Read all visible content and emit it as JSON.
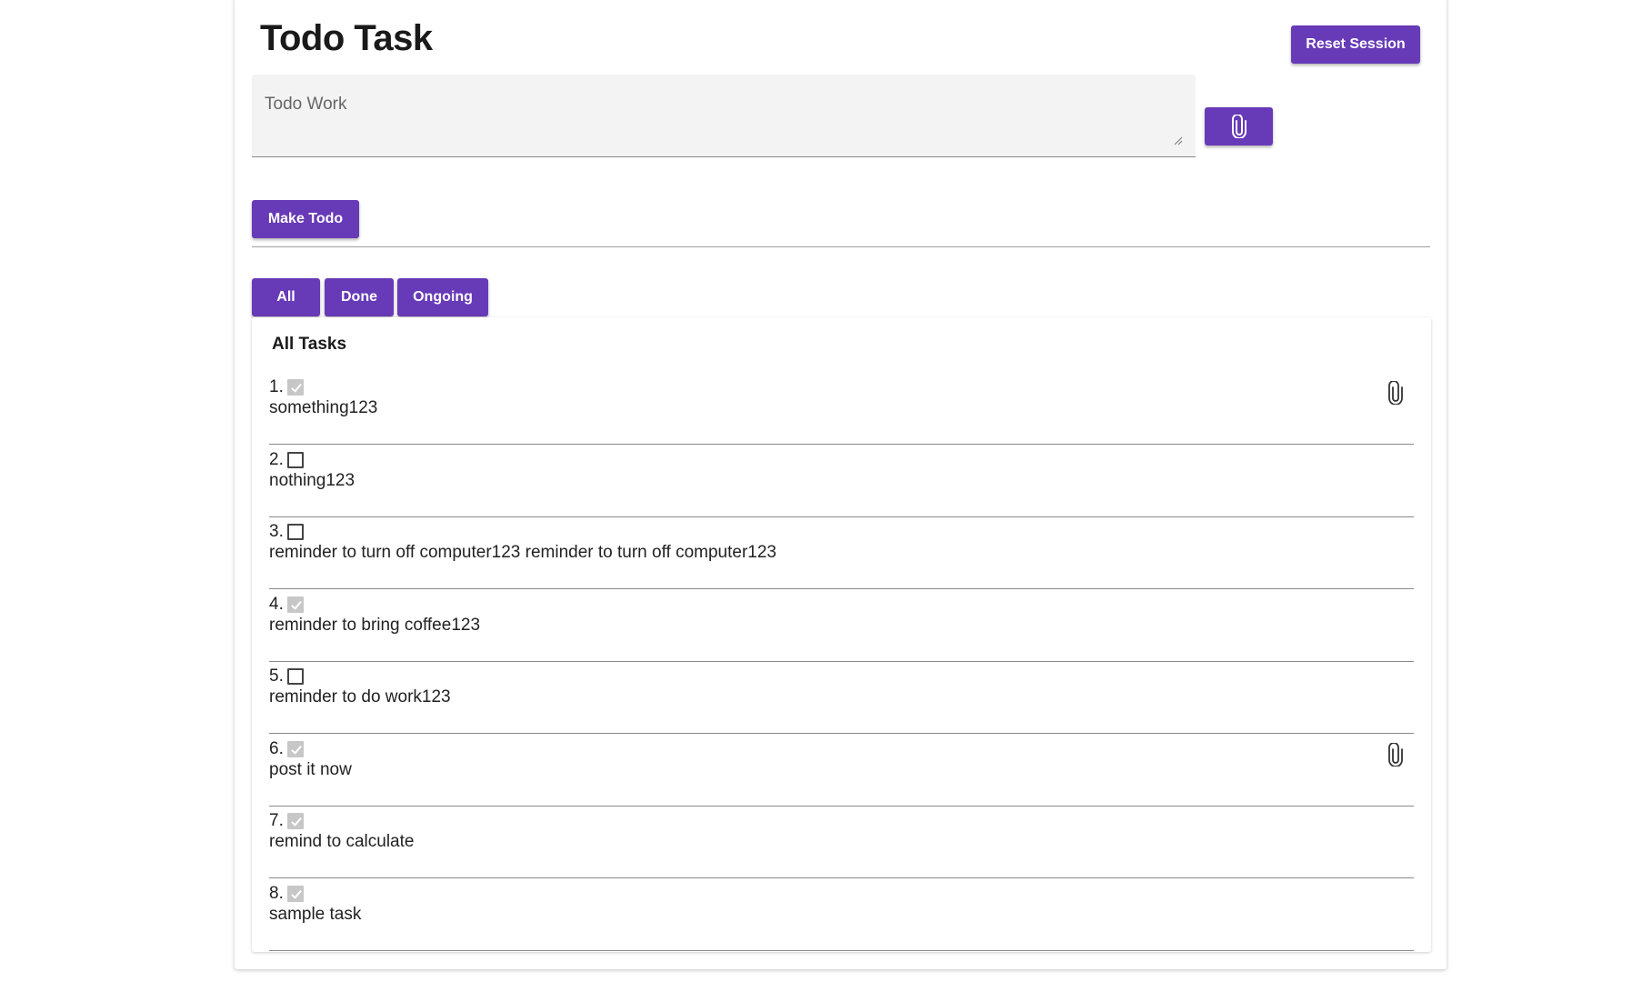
{
  "header": {
    "title": "Todo Task",
    "reset_label": "Reset Session"
  },
  "composer": {
    "placeholder": "Todo Work",
    "attach_icon": "paperclip-icon",
    "make_label": "Make Todo"
  },
  "filters": {
    "all": "All",
    "done": "Done",
    "ongoing": "Ongoing",
    "selected": "All"
  },
  "tasks_panel": {
    "title": "All Tasks",
    "items": [
      {
        "num": "1.",
        "text": "something123",
        "done": true,
        "has_attachment": true
      },
      {
        "num": "2.",
        "text": "nothing123",
        "done": false,
        "has_attachment": false
      },
      {
        "num": "3.",
        "text": "reminder to turn off computer123 reminder to turn off computer123",
        "done": false,
        "has_attachment": false
      },
      {
        "num": "4.",
        "text": "reminder to bring coffee123",
        "done": true,
        "has_attachment": false
      },
      {
        "num": "5.",
        "text": "reminder to do work123",
        "done": false,
        "has_attachment": false
      },
      {
        "num": "6.",
        "text": "post it now",
        "done": true,
        "has_attachment": true
      },
      {
        "num": "7.",
        "text": "remind to calculate",
        "done": true,
        "has_attachment": false
      },
      {
        "num": "8.",
        "text": "sample task",
        "done": true,
        "has_attachment": false
      }
    ]
  },
  "colors": {
    "accent": "#673ab7",
    "checked_box": "#c7c7c7",
    "field_bg": "#f3f3f3"
  }
}
